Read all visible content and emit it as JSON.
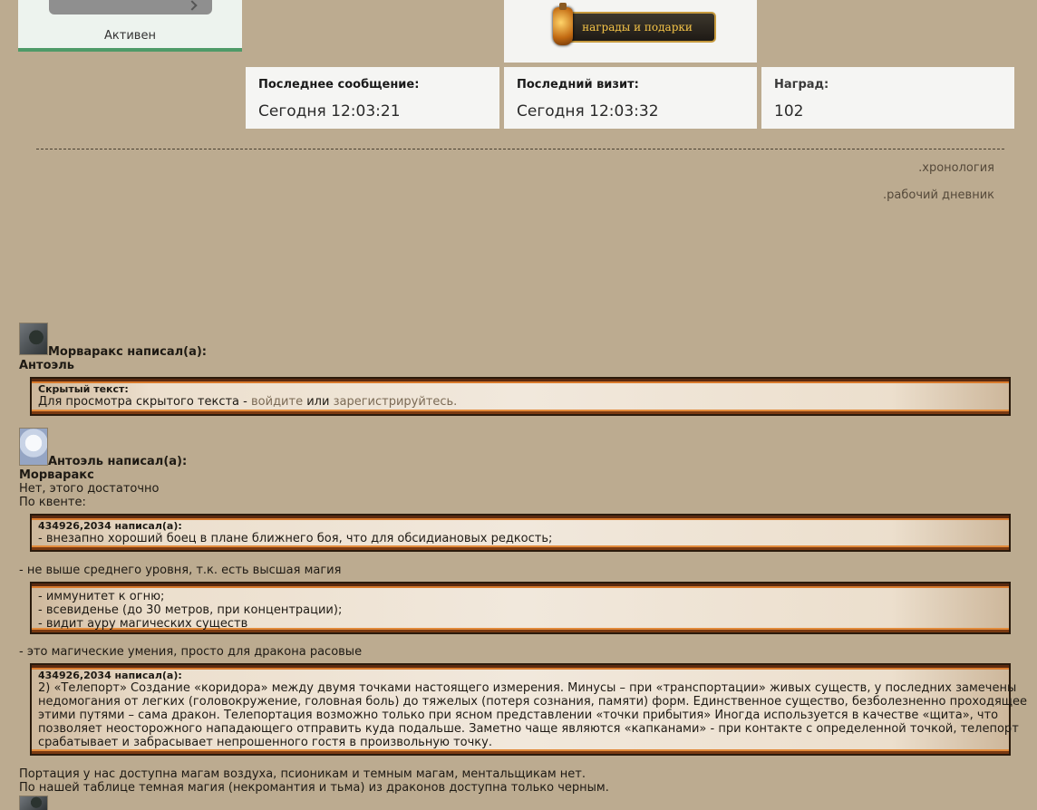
{
  "profile": {
    "status": "Активен",
    "awards_banner": "награды и подарки",
    "stats": [
      {
        "label": "Последнее сообщение:",
        "value": "Сегодня 12:03:21"
      },
      {
        "label": "Последний визит:",
        "value": "Сегодня 12:03:32"
      },
      {
        "label": "Наград:",
        "value": "102"
      }
    ]
  },
  "links": {
    "chronology": ".хронология",
    "diary": ".рабочий дневник"
  },
  "post1": {
    "author": "Морваракс написал(а):",
    "addressee": "Антоэль",
    "hidden_title": "Скрытый текст:",
    "hidden_text_before": "Для просмотра скрытого текста -",
    "login": "войдите",
    "or": "или",
    "register": "зарегистрируйтесь."
  },
  "post2": {
    "author": "Антоэль написал(а):",
    "addressee": "Морваракс",
    "line1": "Нет, этого достаточно",
    "line2": "По квенте:",
    "quote1_head": "434926,2034 написал(а):",
    "quote1_text": "- внезапно хороший боец в плане ближнего боя, что для обсидиановых редкость;",
    "after1": "- не выше среднего уровня, т.к. есть высшая магия",
    "quote2_lines": [
      "- иммунитет к огню;",
      "- всевиденье (до 30 метров, при концентрации);",
      "- видит ауру магических существ"
    ],
    "after2": "- это магические умения, просто для дракона расовые",
    "quote3_head": "434926,2034 написал(а):",
    "quote3_lines": [
      "2) «Телепорт» Создание «коридора» между двумя точками настоящего измерения. Минусы – при «транспортации» живых существ, у последних замечены",
      "недомогания от легких (головокружение, головная боль) до тяжелых (потеря сознания, памяти) форм. Единственное существо, безболезненно проходящее",
      "этими путями – сама дракон. Телепортация возможно только при ясном представлении «точки прибытия» Иногда используется в качестве «щита», что",
      "позволяет неосторожного нападающего отправить куда подальше. Заметно чаще являются «капканами» - при контакте с определенной точкой, телепорт",
      "срабатывает и забрасывает непрошенного гостя в произвольную точку."
    ],
    "final1": "Портация у нас доступна магам воздуха, псионикам и темным магам, ментальщикам нет.",
    "final2": "По нашей таблице темная магия (некромантия и тьма) из драконов доступна только черным."
  }
}
